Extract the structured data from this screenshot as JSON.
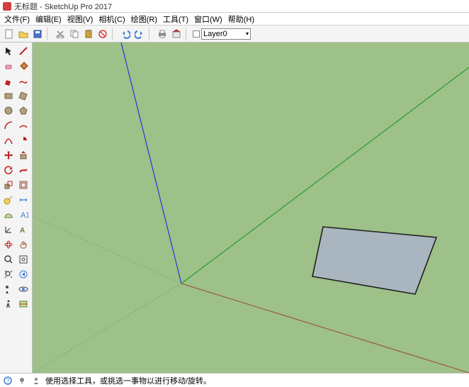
{
  "title": "无标题 - SketchUp Pro 2017",
  "menu": {
    "file": "文件(F)",
    "edit": "编辑(E)",
    "view": "视图(V)",
    "camera": "相机(C)",
    "draw": "绘图(R)",
    "tools": "工具(T)",
    "window": "窗口(W)",
    "help": "帮助(H)"
  },
  "layer_label": "Layer0",
  "status": {
    "hint": "使用选择工具，或挑选一事物以进行移动/旋转。"
  },
  "icons": {
    "new": "new-file-icon",
    "open": "open-icon",
    "save": "save-icon",
    "cut": "cut-icon",
    "copy": "copy-icon",
    "paste": "paste-icon",
    "erase": "erase-icon",
    "undo": "undo-icon",
    "redo": "redo-icon",
    "print": "print-icon",
    "model": "model-icon"
  },
  "tools": [
    "select-tool",
    "make-component-tool",
    "line-tool",
    "eraser-tool",
    "arc-tool",
    "freehand-tool",
    "rectangle-tool",
    "circle-tool",
    "polygon-tool",
    "annotation-tool",
    "move-tool",
    "pushpull-tool",
    "rotate-tool",
    "followme-tool",
    "scale-tool",
    "offset-tool",
    "tape-tool",
    "dimension-tool",
    "paint-tool",
    "text-tool",
    "protractor-tool",
    "axes-tool",
    "orbit-tool",
    "pan-tool",
    "zoom-tool",
    "zoom-extents-tool",
    "position-camera-tool",
    "look-around-tool",
    "walk-tool",
    "section-tool"
  ]
}
